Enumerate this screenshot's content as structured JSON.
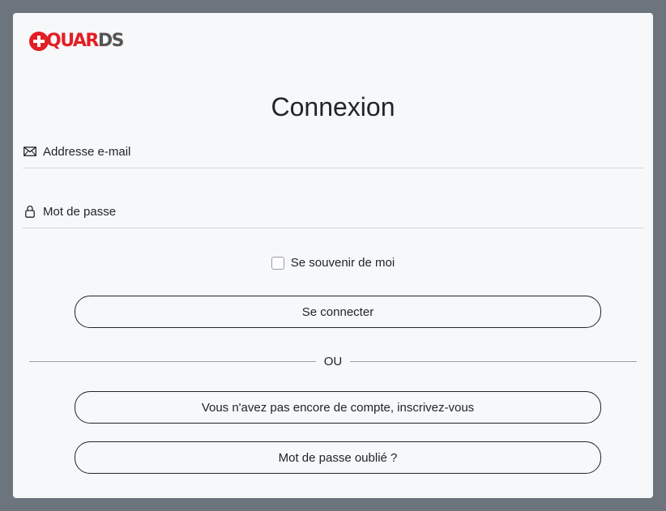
{
  "brand": {
    "logo_red": "Q",
    "logo_mid_red": "UAR",
    "logo_gray": "DS",
    "accent_color": "#e31e24"
  },
  "form": {
    "title": "Connexion",
    "email": {
      "icon": "envelope-icon",
      "placeholder": "Addresse e-mail",
      "value": ""
    },
    "password": {
      "icon": "lock-icon",
      "placeholder": "Mot de passe",
      "value": ""
    },
    "remember": {
      "label": "Se souvenir de moi",
      "checked": false
    },
    "login_button": "Se connecter",
    "divider": "OU",
    "signup_button": "Vous n'avez pas encore de compte, inscrivez-vous",
    "forgot_button": "Mot de passe oublié ?"
  }
}
